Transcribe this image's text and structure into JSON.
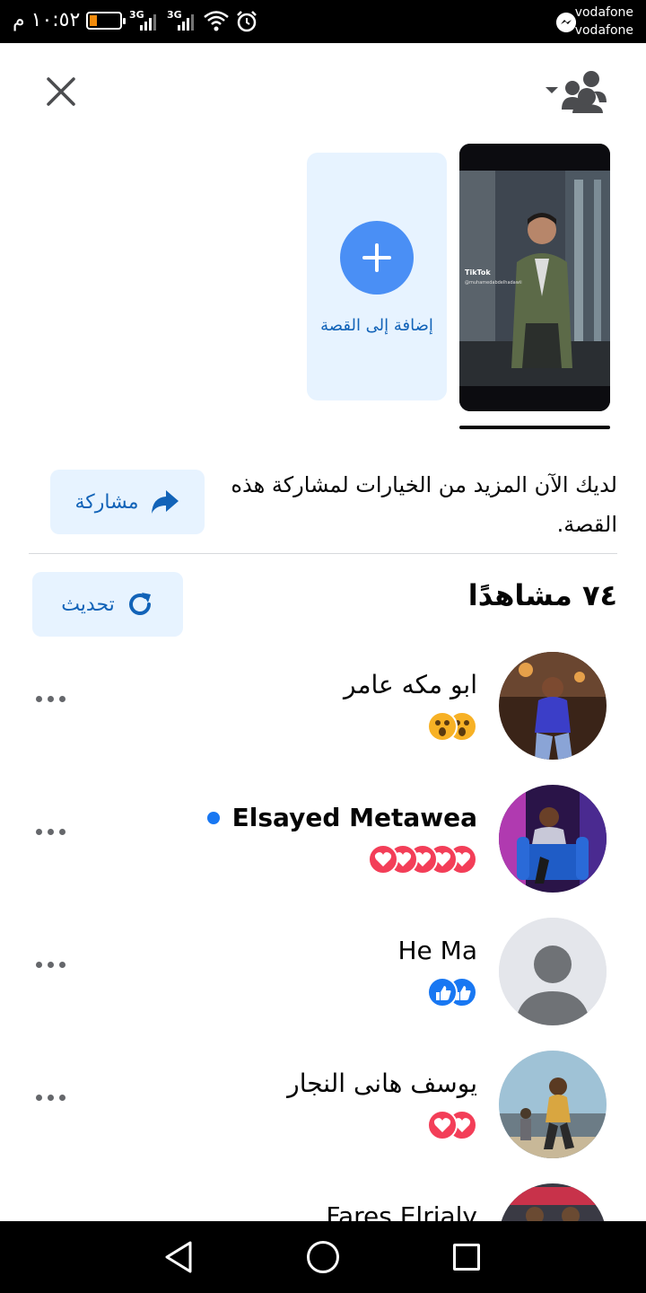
{
  "status_bar": {
    "time": "١٠:٥٢ م",
    "network_1": "3G",
    "network_2": "3G",
    "carrier_1": "vodafone",
    "carrier_2": "vodafone",
    "battery_color": "#f28b0c"
  },
  "header": {
    "close_icon": "close-icon",
    "audience_icon": "audience-friends-icon"
  },
  "stories": {
    "add_label": "إضافة إلى القصة",
    "thumb_watermark": "TikTok",
    "thumb_handle": "@muhamedabdelhadawii"
  },
  "info": {
    "text_line1": "لديك الآن المزيد من الخيارات لمشاركة هذه",
    "text_line2": "القصة.",
    "share_label": "مشاركة"
  },
  "viewers": {
    "count_label": "٧٤ مشاهدًا",
    "refresh_label": "تحديث",
    "items": [
      {
        "name": "ابو مكه عامر",
        "reactions": [
          "wow",
          "wow"
        ],
        "online": false
      },
      {
        "name": "Elsayed Metawea",
        "reactions": [
          "heart",
          "heart",
          "heart",
          "heart",
          "heart"
        ],
        "online": true
      },
      {
        "name": "He Ma",
        "reactions": [
          "like",
          "like"
        ],
        "online": false
      },
      {
        "name": "يوسف هانى النجار",
        "reactions": [
          "heart",
          "heart"
        ],
        "online": false
      },
      {
        "name": "Fares Elrialy",
        "reactions": [],
        "online": false
      }
    ]
  },
  "colors": {
    "accent": "#1263b8",
    "button_bg": "#e7f3ff",
    "add_circle": "#4a8ff5",
    "heart": "#f33e58",
    "like": "#1877f2",
    "wow": "#f7b125"
  }
}
